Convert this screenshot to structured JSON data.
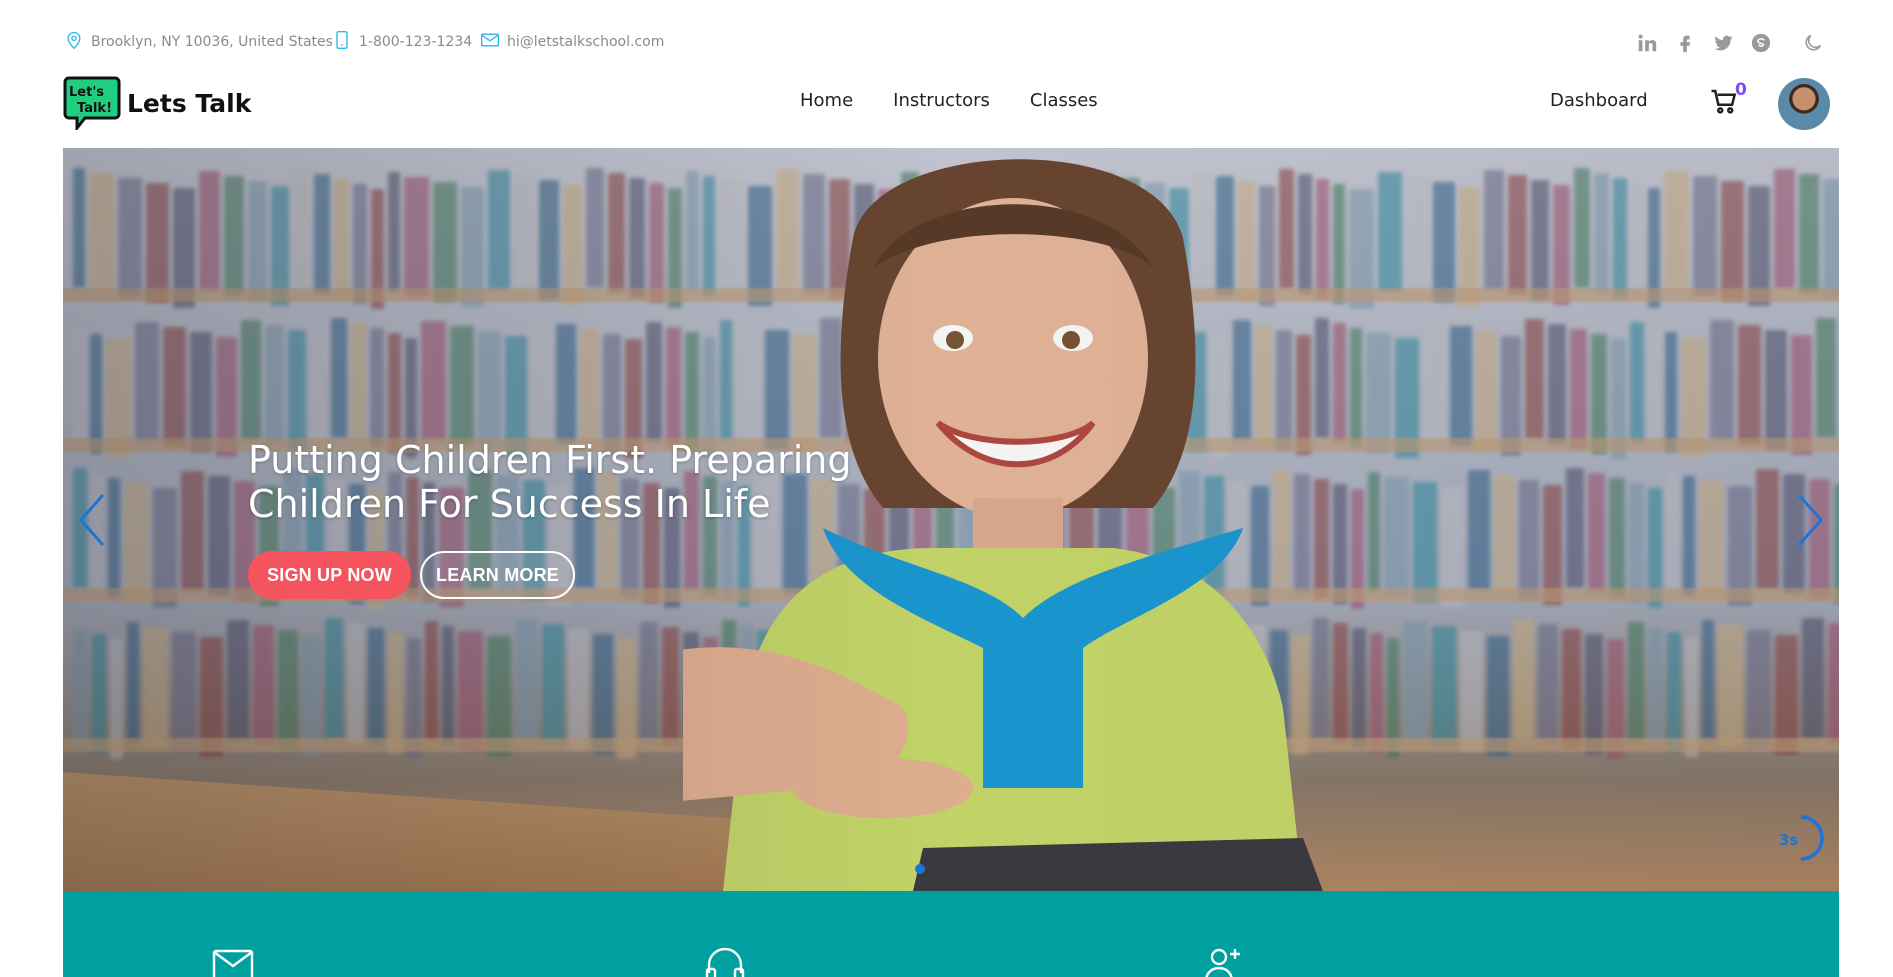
{
  "topbar": {
    "address": "Brooklyn, NY 10036, United States",
    "phone": "1-800-123-1234",
    "email": "hi@letstalkschool.com",
    "social_icons": [
      "linkedin-icon",
      "facebook-icon",
      "twitter-icon",
      "skype-icon"
    ],
    "theme_toggle_icon": "moon-icon"
  },
  "header": {
    "logo_badge_line1": "Let's",
    "logo_badge_line2": "Talk!",
    "logo_text": "Lets Talk",
    "nav": [
      {
        "label": "Home"
      },
      {
        "label": "Instructors"
      },
      {
        "label": "Classes"
      }
    ],
    "dashboard_label": "Dashboard",
    "cart_count": "0"
  },
  "hero": {
    "title": "Putting Children First. Preparing Children For Success In Life",
    "signup_label": "SIGN UP NOW",
    "learn_label": "LEARN MORE",
    "timer_label": "3s"
  },
  "features": {
    "icons": [
      "mail-icon",
      "headphones-icon",
      "user-add-icon"
    ]
  },
  "colors": {
    "accent_red": "#f5535e",
    "teal": "#00a0a0",
    "cart_badge": "#7a4dff",
    "info_icon": "#29b6e8",
    "slider_blue": "#1e73d8"
  }
}
